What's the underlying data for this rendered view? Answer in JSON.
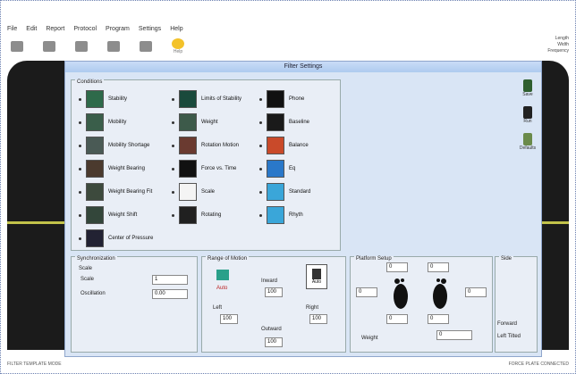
{
  "menubar": {
    "items": [
      "File",
      "Edit",
      "Report",
      "Protocol",
      "Program",
      "Settings",
      "Help"
    ]
  },
  "toolbar": {
    "buttons": [
      {
        "label": "",
        "icon": "user-icon"
      },
      {
        "label": "",
        "icon": "grid-icon"
      },
      {
        "label": "",
        "icon": "people-icon"
      },
      {
        "label": "",
        "icon": "report-icon"
      },
      {
        "label": "",
        "icon": "chart-icon"
      },
      {
        "label": "Help",
        "icon": "help-icon"
      }
    ]
  },
  "rightinfo": {
    "l1": "Length",
    "l2": "Width",
    "l3": "Frequency"
  },
  "dialog": {
    "title": "Filter Settings"
  },
  "conditions": {
    "title": "Conditions",
    "col1": [
      "Stability",
      "Mobility",
      "Mobility Shortage",
      "Weight Bearing",
      "Weight Bearing Fit",
      "Weight Shift",
      "Center of Pressure"
    ],
    "col2": [
      "Limits of Stability",
      "Weight",
      "Rotation Motion",
      "Force vs. Time",
      "Scale",
      "Rotating"
    ],
    "col3": [
      "Phone",
      "Baseline",
      "Balance",
      "Eq",
      "Standard",
      "Rhyth"
    ]
  },
  "side": {
    "items": [
      "Save",
      "Run",
      "Defaults"
    ]
  },
  "synchronization": {
    "title": "Synchronization",
    "sub": "Scale",
    "scale_label": "Scale",
    "scale_value": "1",
    "pos_label": "Oscillation",
    "pos_value": "0.00"
  },
  "range": {
    "title": "Range of Motion",
    "left_label": "Left",
    "left_value": "100",
    "inner_label": "Inward",
    "inner_value": "100",
    "right_label": "Right",
    "right_value": "100",
    "outward_label": "Outward",
    "outward_value": "100",
    "badge": "Auto",
    "auto": "Auto"
  },
  "feet": {
    "title": "Platform Setup",
    "top_left": "0",
    "top_right": "0",
    "mid_left": "0",
    "mid_right": "0",
    "bottom_left": "0",
    "bottom_right": "0",
    "weight_label": "Weight",
    "weight_value": "0"
  },
  "side_group": {
    "title": "Side",
    "radio1": "Forward",
    "radio2": "Left Tilted"
  },
  "status": {
    "left": "FILTER TEMPLATE MODE",
    "right": "FORCE PLATE CONNECTED"
  }
}
